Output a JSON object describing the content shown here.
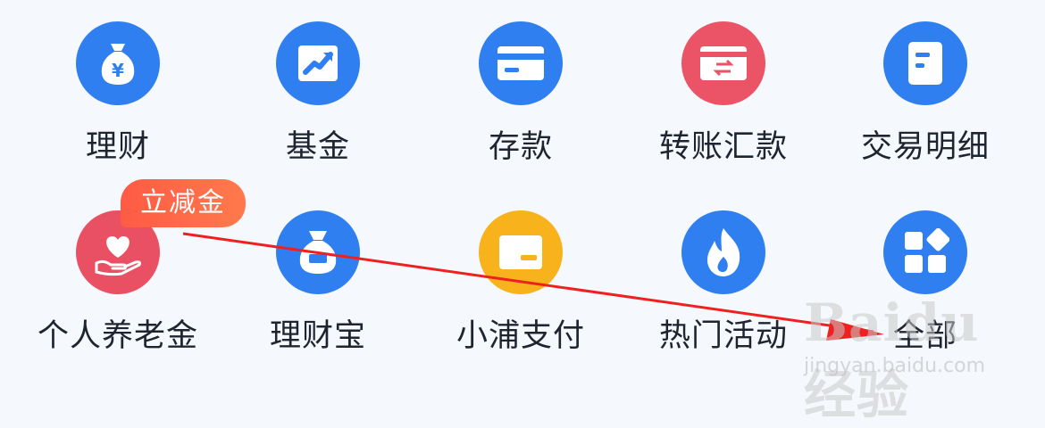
{
  "menu": {
    "row1": [
      {
        "label": "理财",
        "icon": "money-bag-icon",
        "color": "#2f7ff0"
      },
      {
        "label": "基金",
        "icon": "trend-chart-icon",
        "color": "#2f7ff0"
      },
      {
        "label": "存款",
        "icon": "card-icon",
        "color": "#2f7ff0"
      },
      {
        "label": "转账汇款",
        "icon": "transfer-card-icon",
        "color": "#ea5466"
      },
      {
        "label": "交易明细",
        "icon": "document-icon",
        "color": "#2f7ff0"
      }
    ],
    "row2": [
      {
        "label": "个人养老金",
        "icon": "heart-hand-icon",
        "color": "#ea5064"
      },
      {
        "label": "理财宝",
        "icon": "treasure-bag-icon",
        "color": "#2f7ff0"
      },
      {
        "label": "小浦支付",
        "icon": "wallet-icon",
        "color": "#f7b21c"
      },
      {
        "label": "热门活动",
        "icon": "flame-icon",
        "color": "#2f7ff0"
      },
      {
        "label": "全部",
        "icon": "grid-apps-icon",
        "color": "#2f7ff0"
      }
    ]
  },
  "badge": {
    "text": "立减金"
  },
  "watermark": {
    "brand": "Baidu经验",
    "url": "jingyan.baidu.com"
  }
}
